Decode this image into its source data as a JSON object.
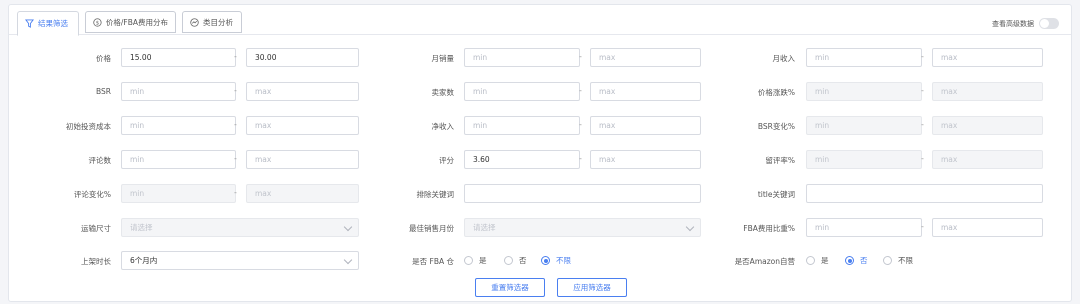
{
  "tabs": [
    {
      "label": "结果筛选",
      "icon": "filter-icon"
    },
    {
      "label": "价格/FBA费用分布",
      "icon": "dollar-icon"
    },
    {
      "label": "类目分析",
      "icon": "trend-icon"
    }
  ],
  "advanced": {
    "label": "查看高级数据"
  },
  "placeholders": {
    "min": "min",
    "max": "max"
  },
  "dash": "-",
  "fields": {
    "price": {
      "label": "价格",
      "min": "15.00",
      "max": "30.00"
    },
    "monthly_sales": {
      "label": "月销量"
    },
    "monthly_revenue": {
      "label": "月收入"
    },
    "bsr": {
      "label": "BSR"
    },
    "sellers": {
      "label": "卖家数"
    },
    "price_change": {
      "label": "价格涨跌%"
    },
    "initial_cost": {
      "label": "初始投资成本"
    },
    "net_income": {
      "label": "净收入"
    },
    "bsr_change": {
      "label": "BSR变化%"
    },
    "reviews": {
      "label": "评论数"
    },
    "rating": {
      "label": "评分",
      "min": "3.60"
    },
    "negative_rate": {
      "label": "留评率%"
    },
    "review_change": {
      "label": "评论变化%"
    },
    "exclude_keyword": {
      "label": "排除关键词"
    },
    "title_keyword": {
      "label": "title关键词"
    },
    "shipping_size": {
      "label": "运输尺寸",
      "placeholder": "请选择"
    },
    "best_month": {
      "label": "最佳销售月份",
      "placeholder": "请选择"
    },
    "fba_fee_ratio": {
      "label": "FBA费用比重%"
    },
    "listing_age": {
      "label": "上架时长",
      "value": "6个月内"
    },
    "is_fba": {
      "label": "是否 FBA 仓",
      "options": [
        "是",
        "否",
        "不限"
      ],
      "selected": "不限"
    },
    "is_amazon": {
      "label": "是否Amazon自营",
      "options": [
        "是",
        "否",
        "不限"
      ],
      "selected": "否"
    }
  },
  "buttons": {
    "reset": "重置筛选器",
    "apply": "应用筛选器"
  },
  "colors": {
    "accent": "#4a7ff0"
  }
}
